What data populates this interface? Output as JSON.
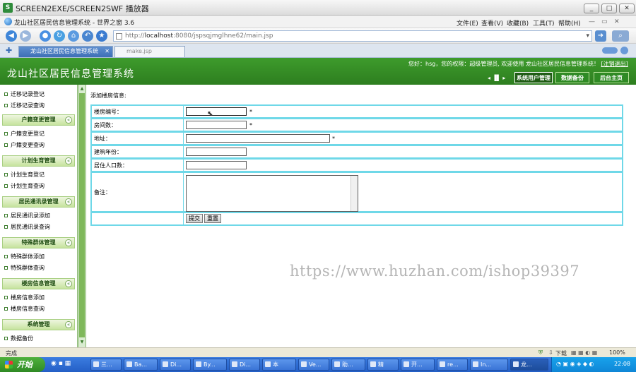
{
  "player": {
    "title": "SCREEN2EXE/SCREEN2SWF 播放器"
  },
  "browser": {
    "title": "龙山社区居民信息管理系统 - 世界之窗 3.6",
    "menu": [
      "文件(E)",
      "查看(V)",
      "收藏(B)",
      "工具(T)",
      "帮助(H)"
    ],
    "address": {
      "prefix": "http://",
      "host": "localhost",
      "rest": ":8080/jspsqjmglhne62/main.jsp"
    },
    "tabs": [
      {
        "label": "龙山社区居民信息管理系统",
        "active": true
      },
      {
        "label": "make.jsp",
        "active": false
      }
    ]
  },
  "app": {
    "title": "龙山社区居民信息管理系统",
    "welcome": "您好：hsg，您的权限：超级管理员, 欢迎使用 龙山社区居民信息管理系统！",
    "logout": "[注销退出]",
    "header_buttons": [
      "系统用户管理",
      "数据备份",
      "后台主页"
    ]
  },
  "sidebar": {
    "top_items": [
      "迁移记录登记",
      "迁移记录查询"
    ],
    "groups": [
      {
        "title": "户籍变更管理",
        "items": [
          "户籍变更登记",
          "户籍变更查询"
        ]
      },
      {
        "title": "计划生育管理",
        "items": [
          "计划生育登记",
          "计划生育查询"
        ]
      },
      {
        "title": "居民通讯录管理",
        "items": [
          "居民通讯录添加",
          "居民通讯录查询"
        ]
      },
      {
        "title": "特殊群体管理",
        "items": [
          "特殊群体添加",
          "特殊群体查询"
        ]
      },
      {
        "title": "楼房信息管理",
        "items": [
          "楼房信息添加",
          "楼房信息查询"
        ]
      },
      {
        "title": "系统管理",
        "items": [
          "数据备份"
        ]
      }
    ]
  },
  "form": {
    "caption": "添加楼房信息:",
    "fields": [
      {
        "label": "楼房编号：",
        "required": "*"
      },
      {
        "label": "房间数：",
        "required": "*"
      },
      {
        "label": "地址：",
        "required": "*"
      },
      {
        "label": "建筑年份：",
        "required": ""
      },
      {
        "label": "居住人口数：",
        "required": ""
      },
      {
        "label": "备注：",
        "required": ""
      }
    ],
    "submit": "提交",
    "reset": "重置"
  },
  "watermark": "https://www.huzhan.com/ishop39397",
  "status": {
    "left": "完成",
    "download": "下载",
    "zoom": "100%"
  },
  "taskbar": {
    "start": "开始",
    "tasks": [
      "三...",
      "Ba...",
      "Di...",
      "By...",
      "Di...",
      "本",
      "Ve...",
      "助...",
      "精",
      "开...",
      "re...",
      "In...",
      "龙..."
    ],
    "time": "22:08"
  },
  "colors": {
    "accent_green": "#3e9b2c",
    "row_border": "#6fd8e8"
  }
}
